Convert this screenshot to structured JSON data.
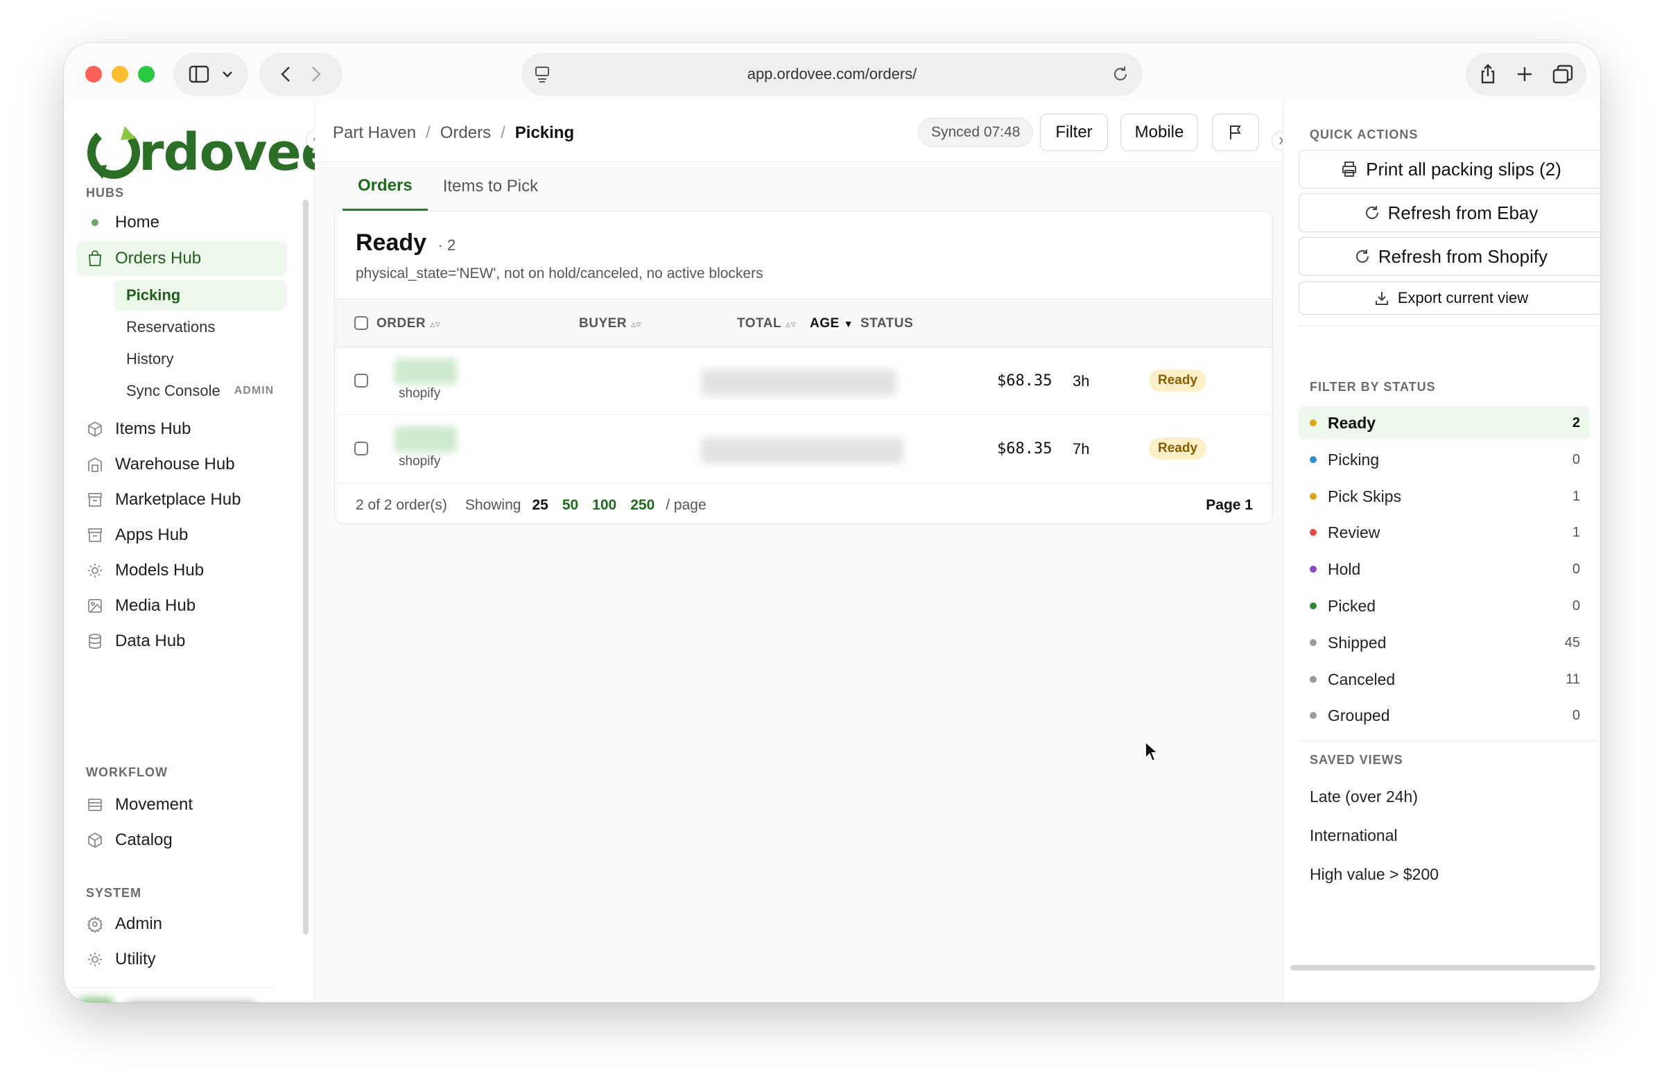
{
  "browser": {
    "url": "app.ordovee.com/orders/"
  },
  "brand": {
    "logo_text": "rdovee",
    "accent": "#2b6e26"
  },
  "sidebar": {
    "hubs_label": "HUBS",
    "workflow_label": "WORKFLOW",
    "system_label": "SYSTEM",
    "home": "Home",
    "orders_hub": "Orders Hub",
    "orders_sub": [
      {
        "label": "Picking"
      },
      {
        "label": "Reservations"
      },
      {
        "label": "History"
      },
      {
        "label": "Sync Console",
        "tag": "ADMIN"
      }
    ],
    "hubs": [
      {
        "label": "Items Hub",
        "icon": "box-icon"
      },
      {
        "label": "Warehouse Hub",
        "icon": "warehouse-icon"
      },
      {
        "label": "Marketplace Hub",
        "icon": "store-icon"
      },
      {
        "label": "Apps Hub",
        "icon": "apps-icon"
      },
      {
        "label": "Models Hub",
        "icon": "sun-icon"
      },
      {
        "label": "Media Hub",
        "icon": "image-icon"
      },
      {
        "label": "Data Hub",
        "icon": "database-icon"
      }
    ],
    "workflow": [
      {
        "label": "Movement",
        "icon": "list-icon"
      },
      {
        "label": "Catalog",
        "icon": "box-icon"
      }
    ],
    "system": [
      {
        "label": "Admin",
        "icon": "gear-icon"
      },
      {
        "label": "Utility",
        "icon": "sun-icon"
      }
    ]
  },
  "topbar": {
    "breadcrumb": [
      "Part Haven",
      "Orders",
      "Picking"
    ],
    "synced": "Synced 07:48",
    "filter_label": "Filter",
    "mobile_label": "Mobile"
  },
  "tabs": [
    "Orders",
    "Items to Pick"
  ],
  "card": {
    "title": "Ready",
    "count": "· 2",
    "description": "physical_state='NEW', not on hold/canceled, no active blockers",
    "columns": {
      "order": "ORDER",
      "buyer": "BUYER",
      "total": "TOTAL",
      "age": "AGE",
      "status": "STATUS"
    },
    "rows": [
      {
        "source": "shopify",
        "total": "$68.35",
        "age": "3h",
        "status": "Ready"
      },
      {
        "source": "shopify",
        "total": "$68.35",
        "age": "7h",
        "status": "Ready"
      }
    ],
    "footer": {
      "summary": "2 of 2 order(s)",
      "showing": "Showing",
      "page_sizes": [
        "25",
        "50",
        "100",
        "250"
      ],
      "per_page": "/ page",
      "page": "Page 1"
    }
  },
  "right_panel": {
    "quick_actions_label": "QUICK ACTIONS",
    "quick_actions": [
      {
        "label": "Print all packing slips (2)",
        "icon": "printer-icon"
      },
      {
        "label": "Refresh from Ebay",
        "icon": "refresh-icon"
      },
      {
        "label": "Refresh from Shopify",
        "icon": "refresh-icon"
      },
      {
        "label": "Export current view",
        "icon": "download-icon"
      }
    ],
    "filter_label": "FILTER BY STATUS",
    "statuses": [
      {
        "label": "Ready",
        "count": "2",
        "color": "#e0a31a"
      },
      {
        "label": "Picking",
        "count": "0",
        "color": "#2f8fd0"
      },
      {
        "label": "Pick Skips",
        "count": "1",
        "color": "#e0a31a"
      },
      {
        "label": "Review",
        "count": "1",
        "color": "#e24a4a"
      },
      {
        "label": "Hold",
        "count": "0",
        "color": "#8a4cc4"
      },
      {
        "label": "Picked",
        "count": "0",
        "color": "#2f8a36"
      },
      {
        "label": "Shipped",
        "count": "45",
        "color": "#9a9a9a"
      },
      {
        "label": "Canceled",
        "count": "11",
        "color": "#9a9a9a"
      },
      {
        "label": "Grouped",
        "count": "0",
        "color": "#9a9a9a"
      }
    ],
    "saved_views_label": "SAVED VIEWS",
    "saved_views": [
      "Late (over 24h)",
      "International",
      "High value > $200"
    ]
  }
}
